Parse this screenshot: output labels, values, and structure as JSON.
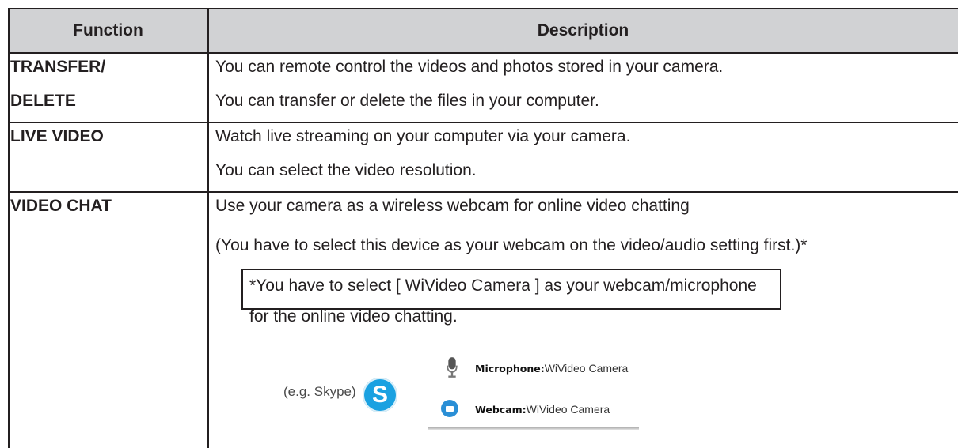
{
  "header": {
    "function": "Function",
    "description": "Description"
  },
  "rows": [
    {
      "function_lines": [
        "TRANSFER/",
        "DELETE"
      ],
      "description_lines": [
        "You can remote control the videos and photos stored in your camera.",
        "You can transfer or delete the files in your computer."
      ]
    },
    {
      "function_lines": [
        "LIVE VIDEO"
      ],
      "description_lines": [
        "Watch live streaming on your computer via your camera.",
        "You can select the video resolution."
      ]
    },
    {
      "function_lines": [
        "VIDEO CHAT"
      ],
      "description_lines": [
        "Use your camera as a wireless webcam for online video chatting",
        "(You have to select this device as your webcam on the video/audio setting first.)*"
      ]
    }
  ],
  "note": {
    "line1": "*You have to select [ WiVideo Camera ] as your webcam/microphone",
    "line2": "for the online video chatting."
  },
  "example": {
    "label": "(e.g. Skype)",
    "skype_letter": "S",
    "microphone_label": "Microphone:",
    "microphone_value": "WiVideo Camera",
    "webcam_label": "Webcam:",
    "webcam_value": "WiVideo Camera"
  },
  "colors": {
    "header_bg": "#d1d2d4",
    "border": "#231f20",
    "skype_blue": "#1aa1e1"
  }
}
